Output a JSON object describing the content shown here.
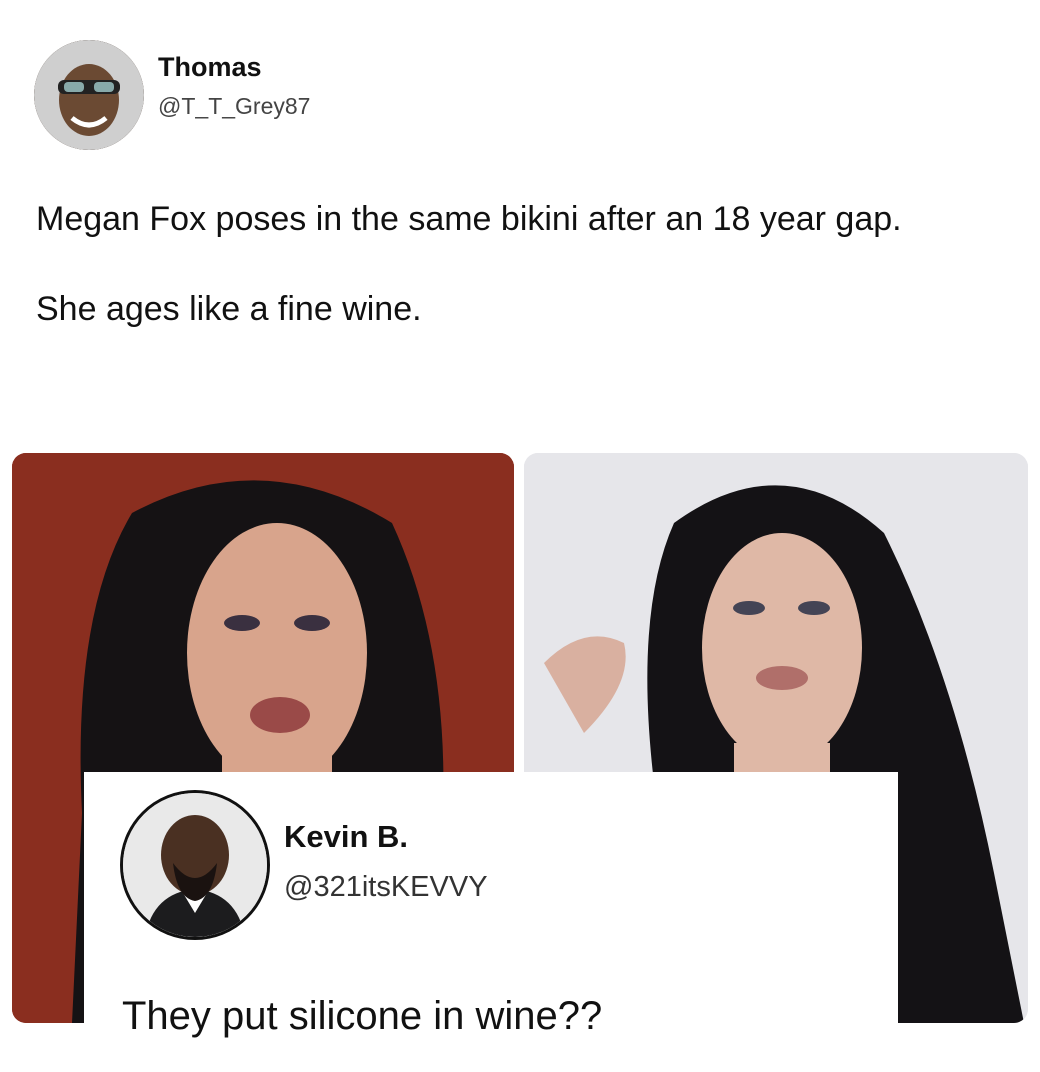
{
  "tweet": {
    "author_name": "Thomas",
    "author_handle": "@T_T_Grey87",
    "avatar_icon": "user-avatar-icon",
    "text_line_1": "Megan Fox poses in the same bikini after an 18 year gap.",
    "text_line_2": "She ages like a fine wine.",
    "photos": [
      {
        "description_icon": "photo-icon",
        "background": "#8a2e1f"
      },
      {
        "description_icon": "photo-icon",
        "background": "#e6e6ea"
      }
    ]
  },
  "reply": {
    "author_name": "Kevin B.",
    "author_handle": "@321itsKEVVY",
    "avatar_icon": "user-avatar-icon",
    "text": "They put silicone in wine??"
  },
  "colors": {
    "text": "#111111",
    "handle": "#444444",
    "background": "#ffffff"
  }
}
